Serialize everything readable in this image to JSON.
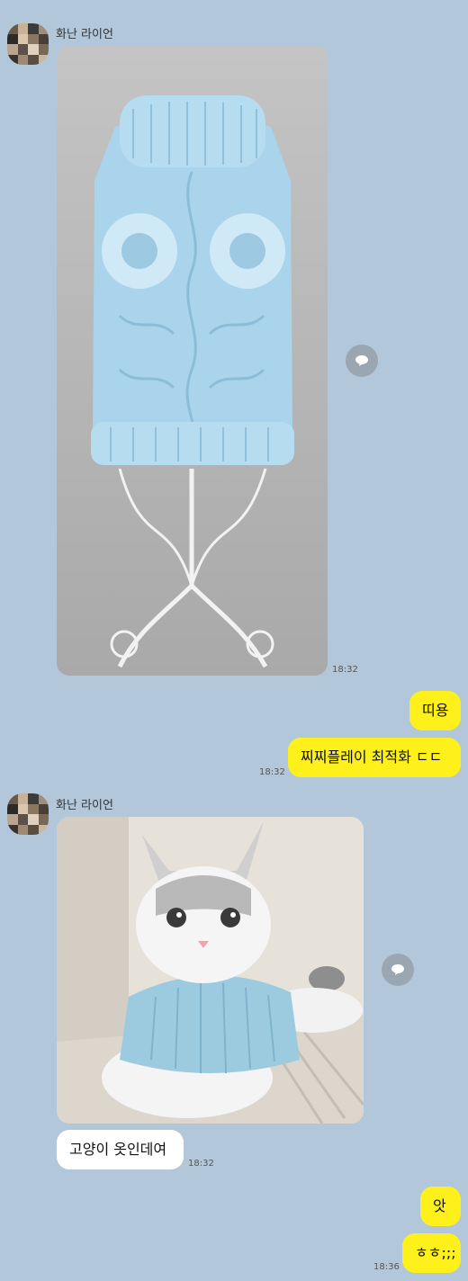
{
  "chat": {
    "messages": [
      {
        "sender": "화난 라이언",
        "type": "image",
        "description": "sweater",
        "time": "18:32"
      },
      {
        "from": "me",
        "text": "띠용"
      },
      {
        "from": "me",
        "text": "찌찌플레이 최적화 ㄷㄷ",
        "time": "18:32"
      },
      {
        "sender": "화난 라이언",
        "type": "image",
        "description": "cat"
      },
      {
        "from": "them",
        "text": "고양이 옷인데여",
        "time": "18:32"
      },
      {
        "from": "me",
        "text": "앗"
      },
      {
        "from": "me",
        "text": "ㅎㅎ;;;",
        "time": "18:36"
      }
    ]
  },
  "colors": {
    "background": "#b2c7da",
    "my_bubble": "#fef01b",
    "their_bubble": "#ffffff"
  },
  "icons": {
    "share": "speech-bubble-icon"
  }
}
